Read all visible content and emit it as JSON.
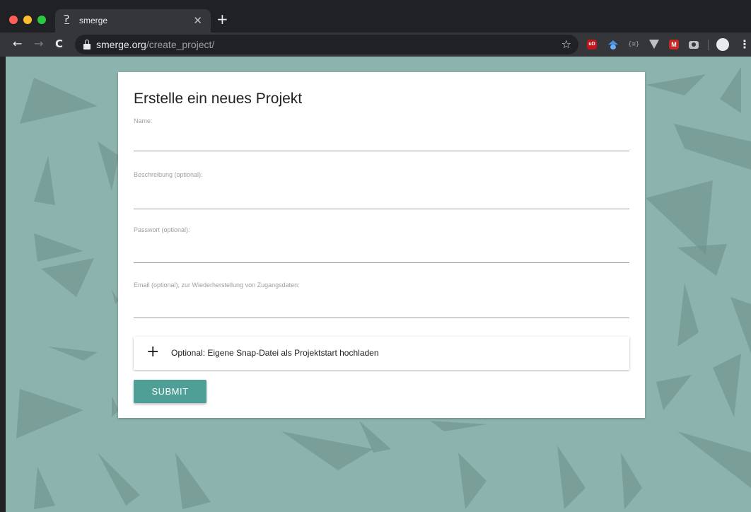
{
  "browser": {
    "tab": {
      "title": "smerge",
      "favicon": "Ɂ̲",
      "close": "✕"
    },
    "new_tab": "+",
    "nav": {
      "back": "←",
      "forward": "→",
      "reload": "C"
    },
    "address": {
      "domain": "smerge.org",
      "path": "/create_project/"
    },
    "star": "☆",
    "extensions": [
      "ublock-origin-icon",
      "capture-icon",
      "json-viewer-icon",
      "vue-devtools-icon",
      "m-extension-icon",
      "camera-icon"
    ],
    "ublock_badge": "uD",
    "json_badge": "{≡}",
    "m_badge": "M",
    "menu": "⋮"
  },
  "form": {
    "title": "Erstelle ein neues Projekt",
    "fields": [
      {
        "label": "Name:",
        "value": ""
      },
      {
        "label": "Beschreibung (optional):",
        "value": ""
      },
      {
        "label": "Passwort (optional):",
        "value": ""
      },
      {
        "label": "Email (optional), zur Wiederherstellung von Zugangsdaten:",
        "value": ""
      }
    ],
    "upload": {
      "icon": "+",
      "label": "Optional: Eigene Snap-Datei als Projektstart hochladen"
    },
    "submit_label": "SUBMIT"
  },
  "colors": {
    "background": "#8db3ae",
    "accent": "#4f9f96",
    "shape": "#6b8e89"
  }
}
